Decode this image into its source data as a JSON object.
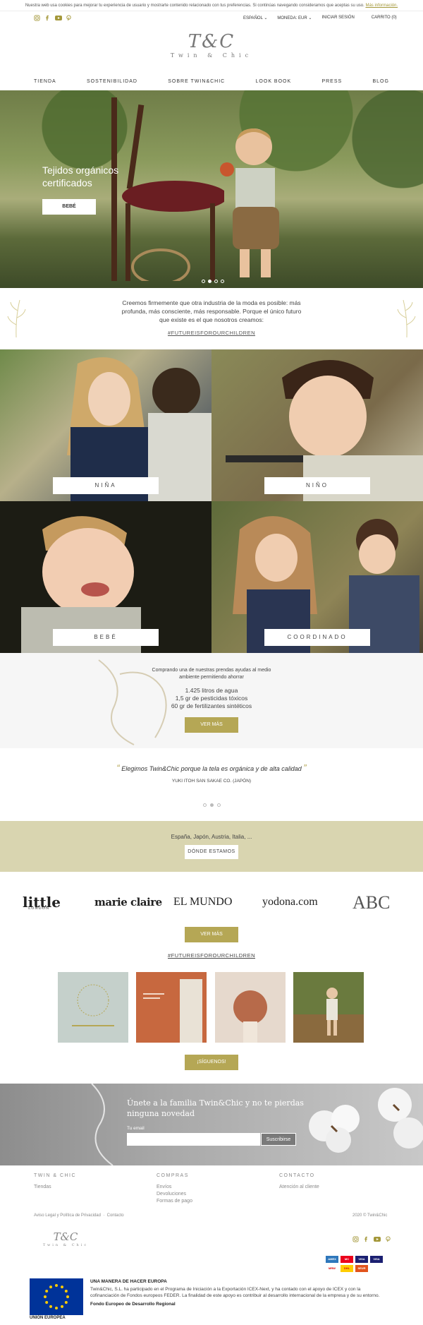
{
  "cookie": {
    "text": "Nuestra web usa cookies para mejorar tu experiencia de usuario y mostrarte contenido relacionado con tus preferencias. Si continúas navegando consideramos que aceptas su uso.",
    "link": "Más información."
  },
  "topbar": {
    "language": "ESPAÑOL",
    "currency": "MONEDA: EUR",
    "login": "INICIAR SESIÓN",
    "cart": "CARRITO (0)"
  },
  "logo": {
    "mark": "T&C",
    "text": "Twin & Chic"
  },
  "nav": [
    "TIENDA",
    "SOSTENIBILIDAD",
    "SOBRE TWIN&CHIC",
    "LOOK BOOK",
    "PRESS",
    "BLOG"
  ],
  "hero": {
    "title": "Tejidos orgánicos certificados",
    "button": "BEBÉ",
    "active_slide": 1,
    "slide_count": 4
  },
  "intro": {
    "text": "Creemos firmemente que otra industria de la moda es posible: más profunda, más consciente, más responsable. Porque el único futuro que existe es el que nosotros creamos:",
    "hashtag": "#FUTUREISFOROURCHILDREN"
  },
  "categories": [
    {
      "label": "NIÑA"
    },
    {
      "label": "NIÑO"
    },
    {
      "label": "BEBÉ"
    },
    {
      "label": "COORDINADO"
    }
  ],
  "eco": {
    "lead": "Comprando una de nuestras prendas ayudas al medio ambiente permitiendo ahorrar",
    "stat1": "1.425 litros de agua",
    "stat2": "1,5 gr de pesticidas tóxicos",
    "stat3": "60 gr de fertilizantes sintéticos",
    "button": "VER MÁS"
  },
  "quote": {
    "open": "“",
    "text": "Elegimos Twin&Chic porque la tela es orgánica y de alta calidad",
    "close": "”",
    "source": "YUKI ITOH SAN SAKAE CO. (JAPÓN)",
    "active_dot": 1,
    "dot_count": 3
  },
  "countries": {
    "text": "España, Japón, Austria, Italia, ...",
    "button": "DÓNDE ESTAMOS"
  },
  "press": {
    "logos": [
      "little",
      "marie claire",
      "EL MUNDO",
      "yodona.com",
      "ABC"
    ],
    "little_sub": "LONDON",
    "button": "VER MÁS"
  },
  "instagram": {
    "hashtag": "#FUTUREISFOROURCHILDREN",
    "button": "¡SÍGUENOS!"
  },
  "newsletter": {
    "title": "Únete a la familia Twin&Chic y no te pierdas ninguna novedad",
    "email_label": "Tu email",
    "submit": "Suscribirse"
  },
  "footer": {
    "col1_title": "TWIN & CHIC",
    "col1_items": [
      "Tiendas"
    ],
    "col2_title": "COMPRAS",
    "col2_items": [
      "Envíos",
      "Devoluciones",
      "Formas de pago"
    ],
    "col3_title": "CONTACTO",
    "col3_items": [
      "Atención al cliente"
    ],
    "legal": "Aviso Legal y Política de Privacidad",
    "contact": "Contacto",
    "copyright": "2020 © Twin&Chic",
    "logo_text": "Twin & Chic",
    "payments": [
      "AMEX",
      "MC",
      "VISA",
      "VISA",
      "MRW",
      "DHL",
      "SEUR"
    ],
    "eu_title": "UNA MANERA DE HACER EUROPA",
    "eu_text": "Twin&Chic, S.L. ha participado en el Programa de Iniciación a la Exportación ICEX-Next, y ha contado con el apoyo de ICEX y con la cofinanciación de Fondos europeos FEDER. La finalidad de este apoyo es contribuir al desarrollo internacional de la empresa y de su entorno.",
    "eu_fund": "Fondo Europeo de Desarrollo Regional",
    "eu_label": "UNIÓN EUROPEA"
  },
  "colors": {
    "accent": "#b5a755",
    "band": "#d9d5b0"
  }
}
